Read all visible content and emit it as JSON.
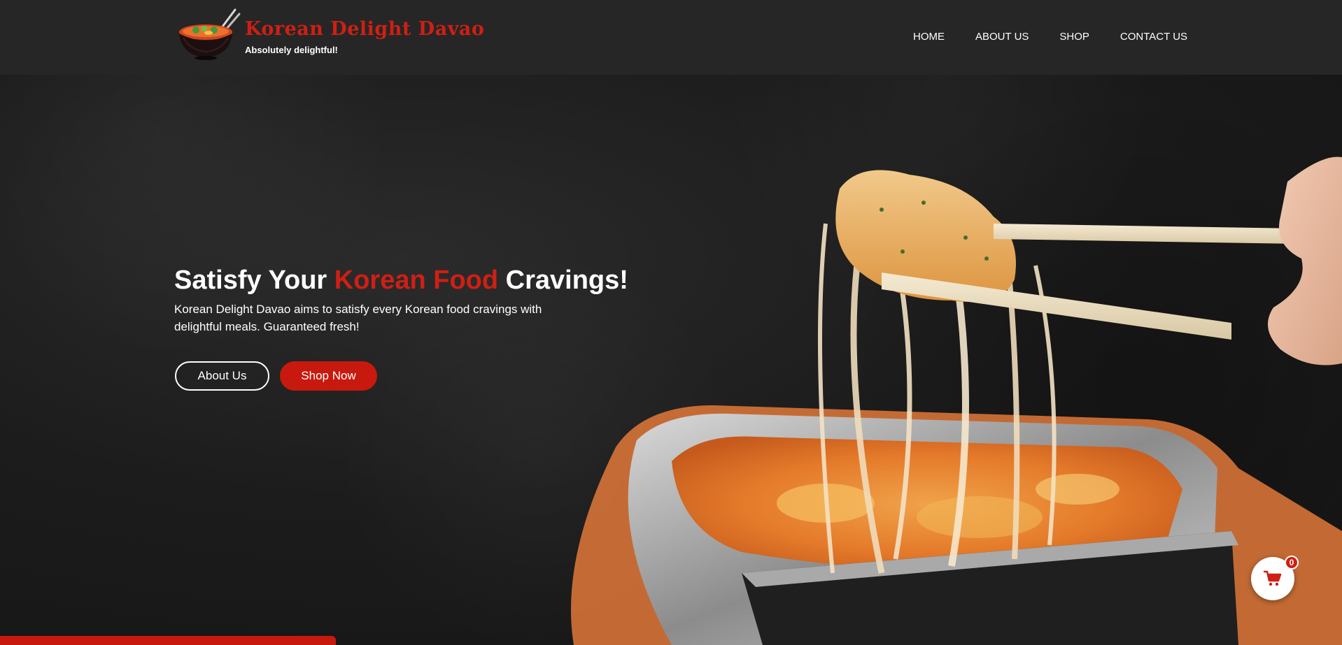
{
  "header": {
    "brand_name": "Korean Delight Davao",
    "tagline": "Absolutely delightful!",
    "nav": [
      {
        "label": "HOME"
      },
      {
        "label": "ABOUT US"
      },
      {
        "label": "SHOP"
      },
      {
        "label": "CONTACT US"
      }
    ]
  },
  "hero": {
    "title_prefix": "Satisfy Your ",
    "title_accent": "Korean Food",
    "title_suffix": " Cravings!",
    "description": "Korean Delight Davao aims to satisfy every Korean food cravings with delightful meals. Guaranteed fresh!",
    "buttons": {
      "about": "About Us",
      "shop": "Shop Now"
    }
  },
  "cart": {
    "count": "0"
  },
  "colors": {
    "accent": "#cf1f14",
    "header_bg": "#262626",
    "page_bg": "#1c1c1c",
    "text": "#ffffff"
  },
  "icons": {
    "logo": "ramen-bowl-icon",
    "cart": "shopping-cart-icon"
  }
}
